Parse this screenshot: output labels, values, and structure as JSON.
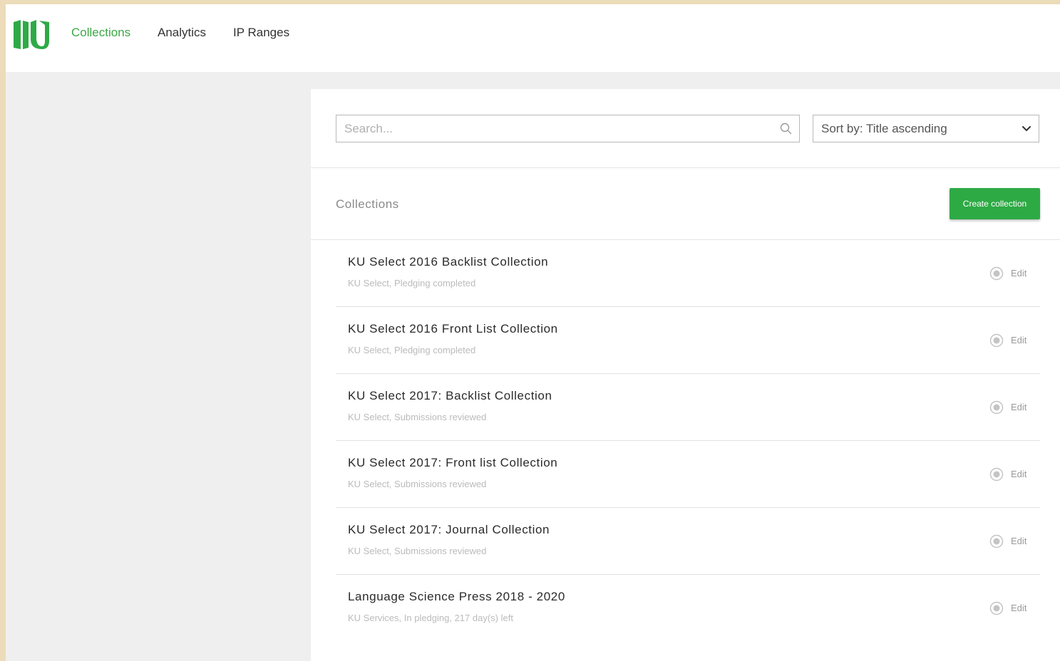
{
  "colors": {
    "brand_green": "#3aa844",
    "button_green": "#2eaa45",
    "page_background": "#efefef"
  },
  "header": {
    "logo_icon": "ku-logo-icon",
    "nav": [
      {
        "label": "Collections",
        "active": true
      },
      {
        "label": "Analytics",
        "active": false
      },
      {
        "label": "IP Ranges",
        "active": false
      }
    ]
  },
  "search": {
    "placeholder": "Search...",
    "value": "",
    "icon": "search-icon"
  },
  "sort": {
    "label": "Sort by: Title ascending",
    "icon": "chevron-down-icon"
  },
  "collections": {
    "title": "Collections",
    "create_label": "Create collection",
    "edit_icon": "edit-radio-icon",
    "items": [
      {
        "title": "KU Select 2016 Backlist Collection",
        "subtitle": "KU Select, Pledging completed",
        "edit_label": "Edit"
      },
      {
        "title": "KU Select 2016 Front List Collection",
        "subtitle": "KU Select, Pledging completed",
        "edit_label": "Edit"
      },
      {
        "title": "KU Select 2017: Backlist Collection",
        "subtitle": "KU Select, Submissions reviewed",
        "edit_label": "Edit"
      },
      {
        "title": "KU Select 2017: Front list Collection",
        "subtitle": "KU Select, Submissions reviewed",
        "edit_label": "Edit"
      },
      {
        "title": "KU Select 2017: Journal Collection",
        "subtitle": "KU Select, Submissions reviewed",
        "edit_label": "Edit"
      },
      {
        "title": "Language Science Press 2018 - 2020",
        "subtitle": "KU Services, In pledging, 217 day(s) left",
        "edit_label": "Edit"
      }
    ]
  }
}
